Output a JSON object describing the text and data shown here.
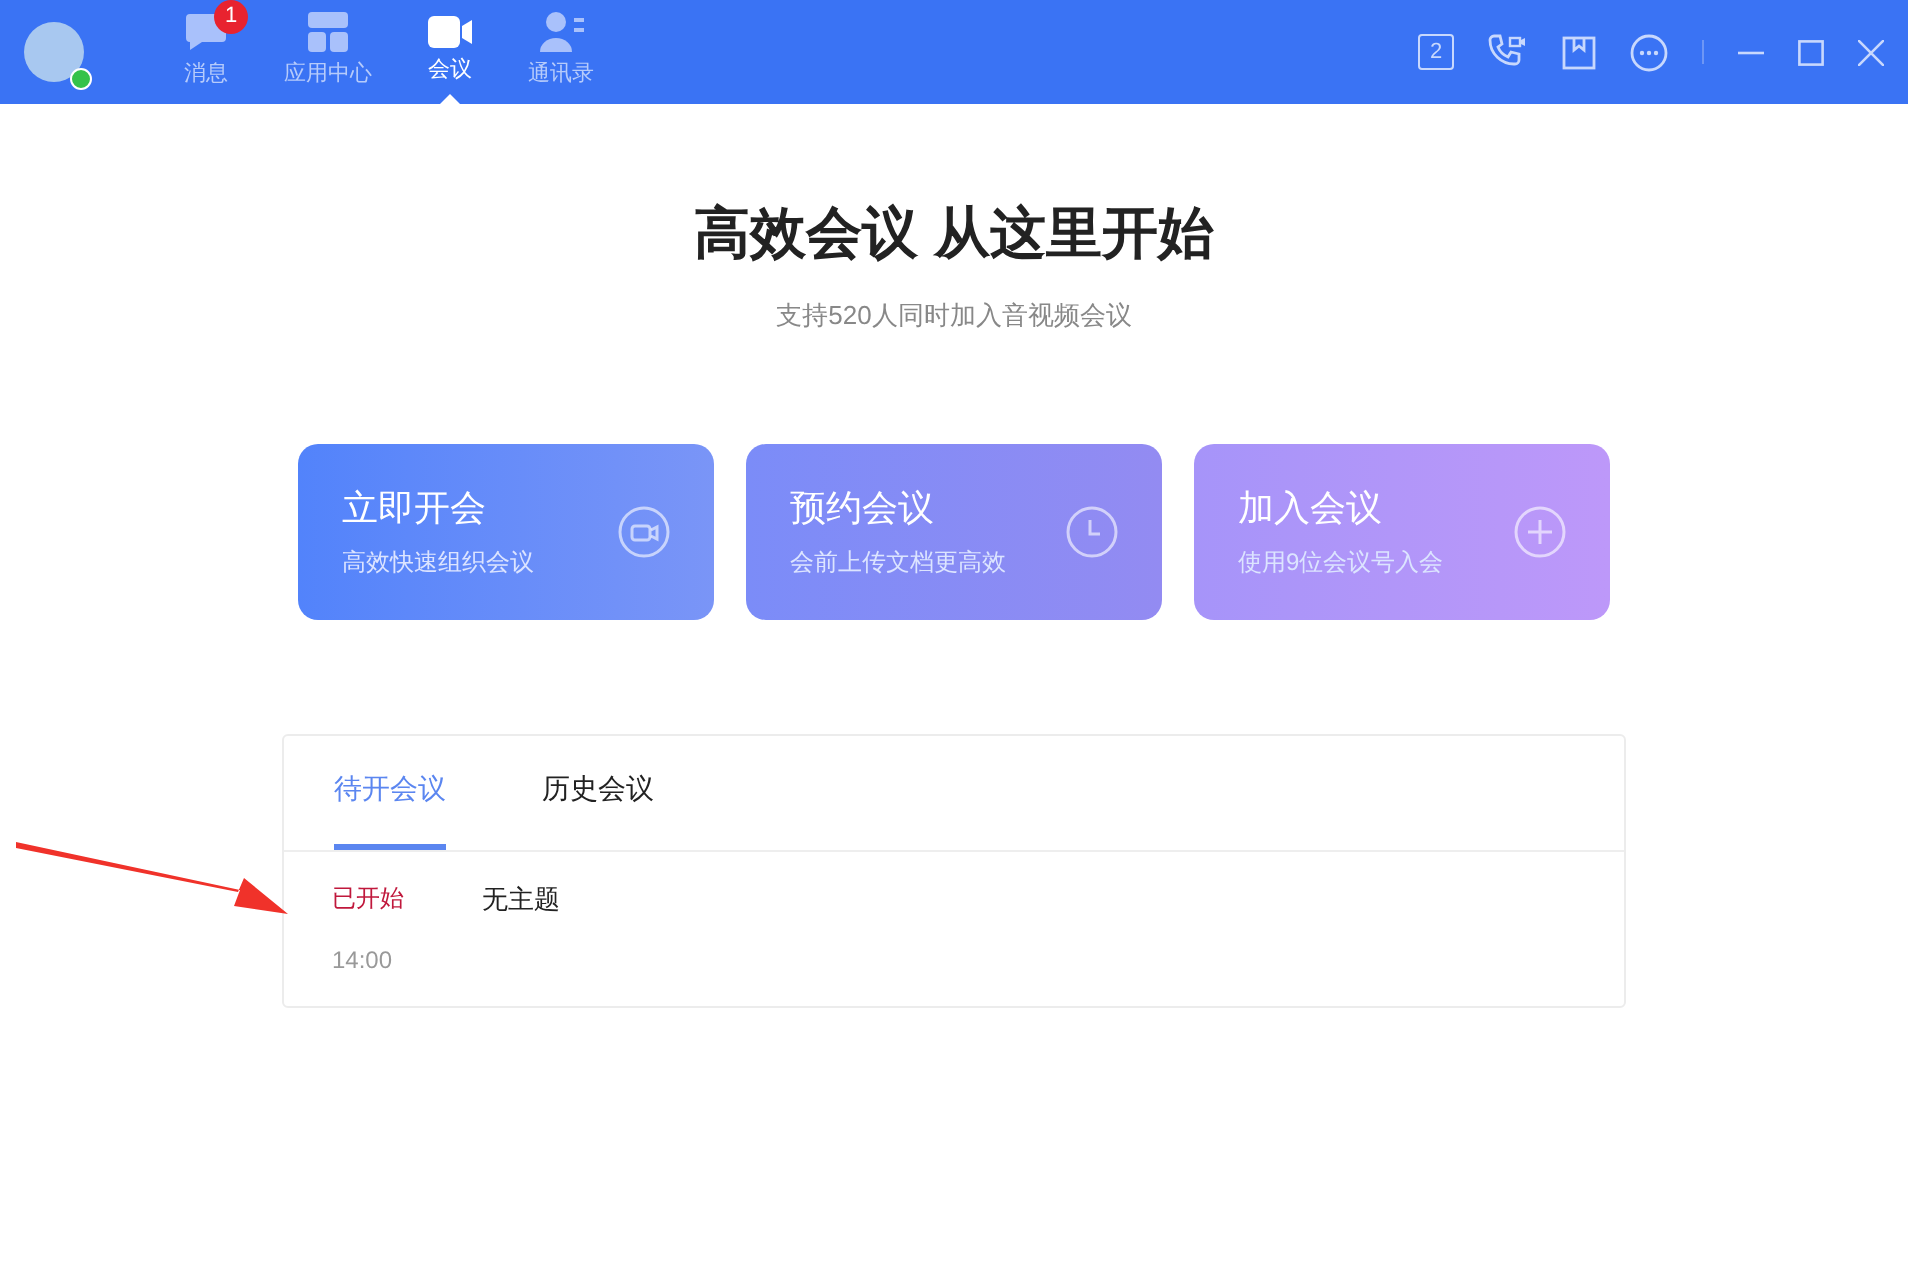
{
  "nav": [
    {
      "kind": "chat",
      "label": "消息",
      "badge": "1",
      "selected": false
    },
    {
      "kind": "apps",
      "label": "应用中心",
      "selected": false
    },
    {
      "kind": "video",
      "label": "会议",
      "selected": true
    },
    {
      "kind": "contacts",
      "label": "通讯录",
      "selected": false
    }
  ],
  "calendar_day": "2",
  "hero": {
    "title": "高效会议 从这里开始",
    "subtitle": "支持520人同时加入音视频会议"
  },
  "actions": [
    {
      "kind": "video",
      "title": "立即开会",
      "subtitle": "高效快速组织会议"
    },
    {
      "kind": "clock",
      "title": "预约会议",
      "subtitle": "会前上传文档更高效"
    },
    {
      "kind": "plus",
      "title": "加入会议",
      "subtitle": "使用9位会议号入会"
    }
  ],
  "tabs": [
    {
      "label": "待开会议",
      "selected": true
    },
    {
      "label": "历史会议",
      "selected": false
    }
  ],
  "meetings": [
    {
      "status": "已开始",
      "title": "无主题",
      "time": "14:00"
    }
  ]
}
